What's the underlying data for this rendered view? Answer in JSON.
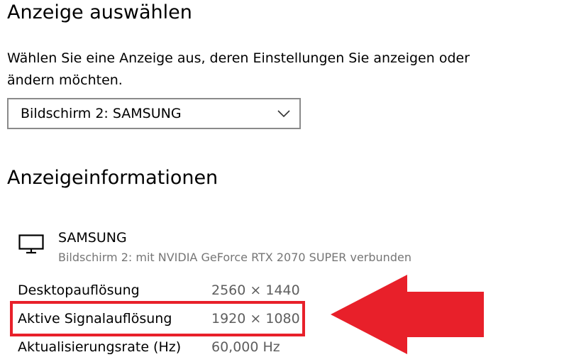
{
  "section_select": {
    "title": "Anzeige auswählen",
    "description": "Wählen Sie eine Anzeige aus, deren Einstellungen Sie anzeigen oder ändern möchten.",
    "dropdown_value": "Bildschirm 2: SAMSUNG"
  },
  "section_info": {
    "title": "Anzeigeinformationen",
    "display_name": "SAMSUNG",
    "display_subtitle": "Bildschirm 2: mit NVIDIA GeForce RTX 2070 SUPER verbunden",
    "rows": [
      {
        "label": "Desktopauflösung",
        "value": "2560 × 1440"
      },
      {
        "label": "Aktive Signalauflösung",
        "value": "1920 × 1080"
      },
      {
        "label": "Aktualisierungsrate (Hz)",
        "value": "60,000 Hz"
      }
    ]
  },
  "icons": {
    "dropdown": "chevron-down-icon",
    "display": "monitor-icon"
  },
  "colors": {
    "highlight": "#e8202a",
    "arrow": "#e8202a",
    "secondary_text": "#767676"
  }
}
